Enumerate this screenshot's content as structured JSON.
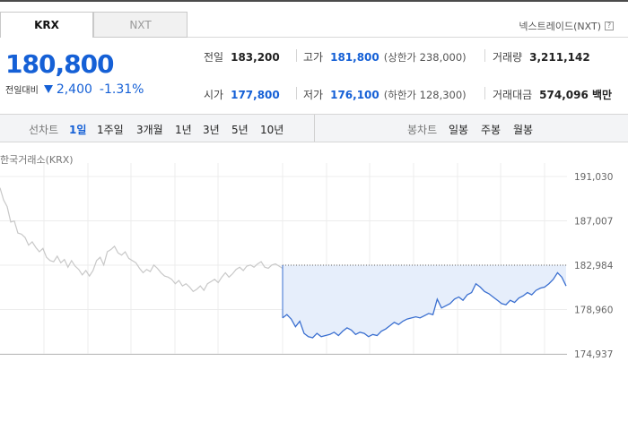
{
  "tabs": [
    {
      "label": "KRX",
      "active": true
    },
    {
      "label": "NXT",
      "active": false
    }
  ],
  "nxt_link": {
    "label": "넥스트레이드(NXT)",
    "help_glyph": "?"
  },
  "price": {
    "current": "180,800",
    "change_label": "전일대비",
    "change_value": "2,400",
    "change_pct": "-1.31%",
    "direction": "down",
    "color": "#1560d6"
  },
  "stats": {
    "prev_close": {
      "label": "전일",
      "value": "183,200"
    },
    "high": {
      "label": "고가",
      "value": "181,800",
      "limit": "(상한가 238,000)"
    },
    "volume": {
      "label": "거래량",
      "value": "3,211,142"
    },
    "open": {
      "label": "시가",
      "value": "177,800"
    },
    "low": {
      "label": "저가",
      "value": "176,100",
      "limit": "(하한가 128,300)"
    },
    "amount": {
      "label": "거래대금",
      "value": "574,096 백만"
    }
  },
  "toolbar": {
    "line_label": "선차트",
    "periods": [
      "1일",
      "1주일",
      "3개월",
      "1년",
      "3년",
      "5년",
      "10년"
    ],
    "active_period": "1일",
    "candle_label": "봉차트",
    "candles": [
      "일봉",
      "주봉",
      "월봉"
    ]
  },
  "chart_data": {
    "type": "line",
    "source_label": "한국거래소(KRX)",
    "y_ticks": [
      "191,030",
      "187,007",
      "182,984",
      "178,960",
      "174,937"
    ],
    "ylim": [
      174937,
      191030
    ],
    "reference_line": 182984,
    "grid": true,
    "series": [
      {
        "color": "#c8c8c8",
        "values": [
          190000,
          188900,
          188300,
          186900,
          187000,
          185900,
          185800,
          185500,
          184800,
          185100,
          184600,
          184200,
          184500,
          183700,
          183400,
          183300,
          183800,
          183200,
          183500,
          182800,
          183400,
          182900,
          182600,
          182100,
          182500,
          182000,
          182500,
          183400,
          183700,
          183000,
          184200,
          184400,
          184700,
          184100,
          183900,
          184200,
          183600,
          183400,
          183200,
          182700,
          182300,
          182600,
          182400,
          183000,
          182700,
          182300,
          182000,
          181900,
          181700,
          181300,
          181600,
          181100,
          181300,
          181000,
          180600,
          180800,
          181100,
          180700,
          181300,
          181500,
          181700,
          181400,
          181900,
          182300,
          181900,
          182200,
          182600,
          182800,
          182500,
          182900,
          183000,
          182800,
          183100,
          183300,
          182800,
          182700,
          183000,
          183100,
          182900,
          182700
        ]
      },
      {
        "color": "#3a6fd0",
        "fill": "#e6eefb",
        "values": [
          178200,
          178500,
          178100,
          177400,
          177900,
          176800,
          176500,
          176400,
          176800,
          176500,
          176600,
          176700,
          176900,
          176600,
          177000,
          177300,
          177100,
          176700,
          176900,
          176800,
          176500,
          176700,
          176600,
          177000,
          177200,
          177500,
          177800,
          177600,
          177900,
          178100,
          178200,
          178300,
          178200,
          178400,
          178600,
          178500,
          179900,
          179100,
          179300,
          179500,
          179900,
          180100,
          179800,
          180300,
          180500,
          181300,
          181000,
          180600,
          180400,
          180100,
          179800,
          179500,
          179400,
          179800,
          179600,
          180000,
          180200,
          180500,
          180300,
          180700,
          180900,
          181000,
          181300,
          181700,
          182300,
          181900,
          181100
        ]
      }
    ]
  }
}
